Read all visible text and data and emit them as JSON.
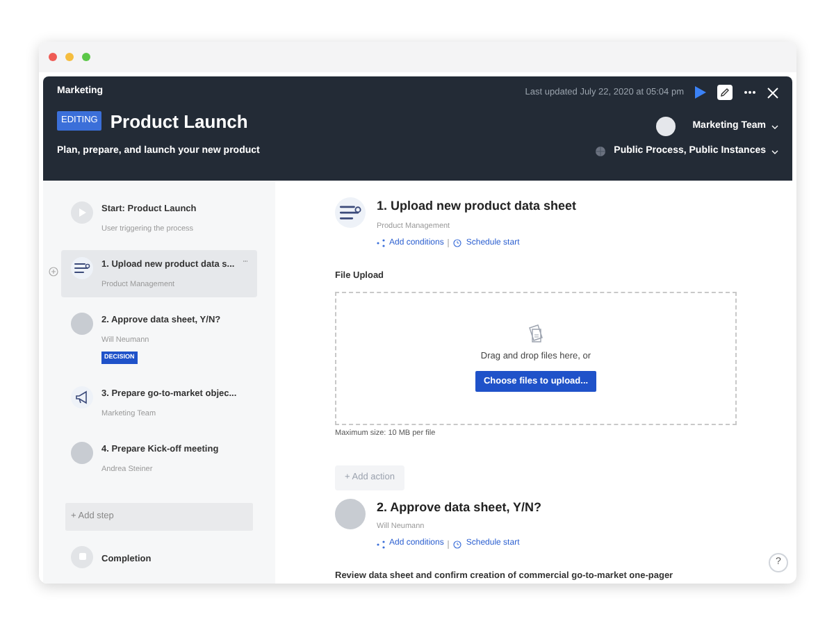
{
  "header": {
    "breadcrumb": "Marketing",
    "badge": "EDITING",
    "title": "Product Launch",
    "subtitle": "Plan, prepare, and launch your new product",
    "last_updated": "Last updated July 22, 2020 at 05:04 pm",
    "owner": "Marketing Team",
    "visibility": "Public Process, Public Instances"
  },
  "steps": [
    {
      "kind": "start",
      "title": "Start: Product Launch",
      "subtitle": "User triggering the process",
      "selected": false
    },
    {
      "kind": "task",
      "title": "1. Upload new product data s...",
      "subtitle": "Product Management",
      "selected": true
    },
    {
      "kind": "person",
      "title": "2. Approve data sheet, Y/N?",
      "subtitle": "Will Neumann",
      "badge": "DECISION",
      "selected": false
    },
    {
      "kind": "announce",
      "title": "3. Prepare go-to-market objec...",
      "subtitle": "Marketing Team",
      "selected": false
    },
    {
      "kind": "person",
      "title": "4. Prepare Kick-off meeting",
      "subtitle": "Andrea Steiner",
      "selected": false
    },
    {
      "kind": "add",
      "title": "+ Add step"
    },
    {
      "kind": "end",
      "title": "Completion",
      "selected": false
    }
  ],
  "detail": [
    {
      "kind": "task",
      "title": "1. Upload new product data sheet",
      "subtitle": "Product Management",
      "links": [
        "Add conditions",
        "Schedule start"
      ]
    },
    {
      "kind": "person",
      "title": "2. Approve data sheet, Y/N?",
      "subtitle": "Will Neumann",
      "links": [
        "Add conditions",
        "Schedule start"
      ]
    }
  ],
  "upload": {
    "label": "File Upload",
    "hint": "Drag and drop files here, or",
    "button": "Choose files to upload...",
    "note": "Maximum size: 10 MB per file"
  },
  "add_action": "+ Add action",
  "description": "Review data sheet and confirm creation of commercial go-to-market one-pager",
  "help": "?"
}
